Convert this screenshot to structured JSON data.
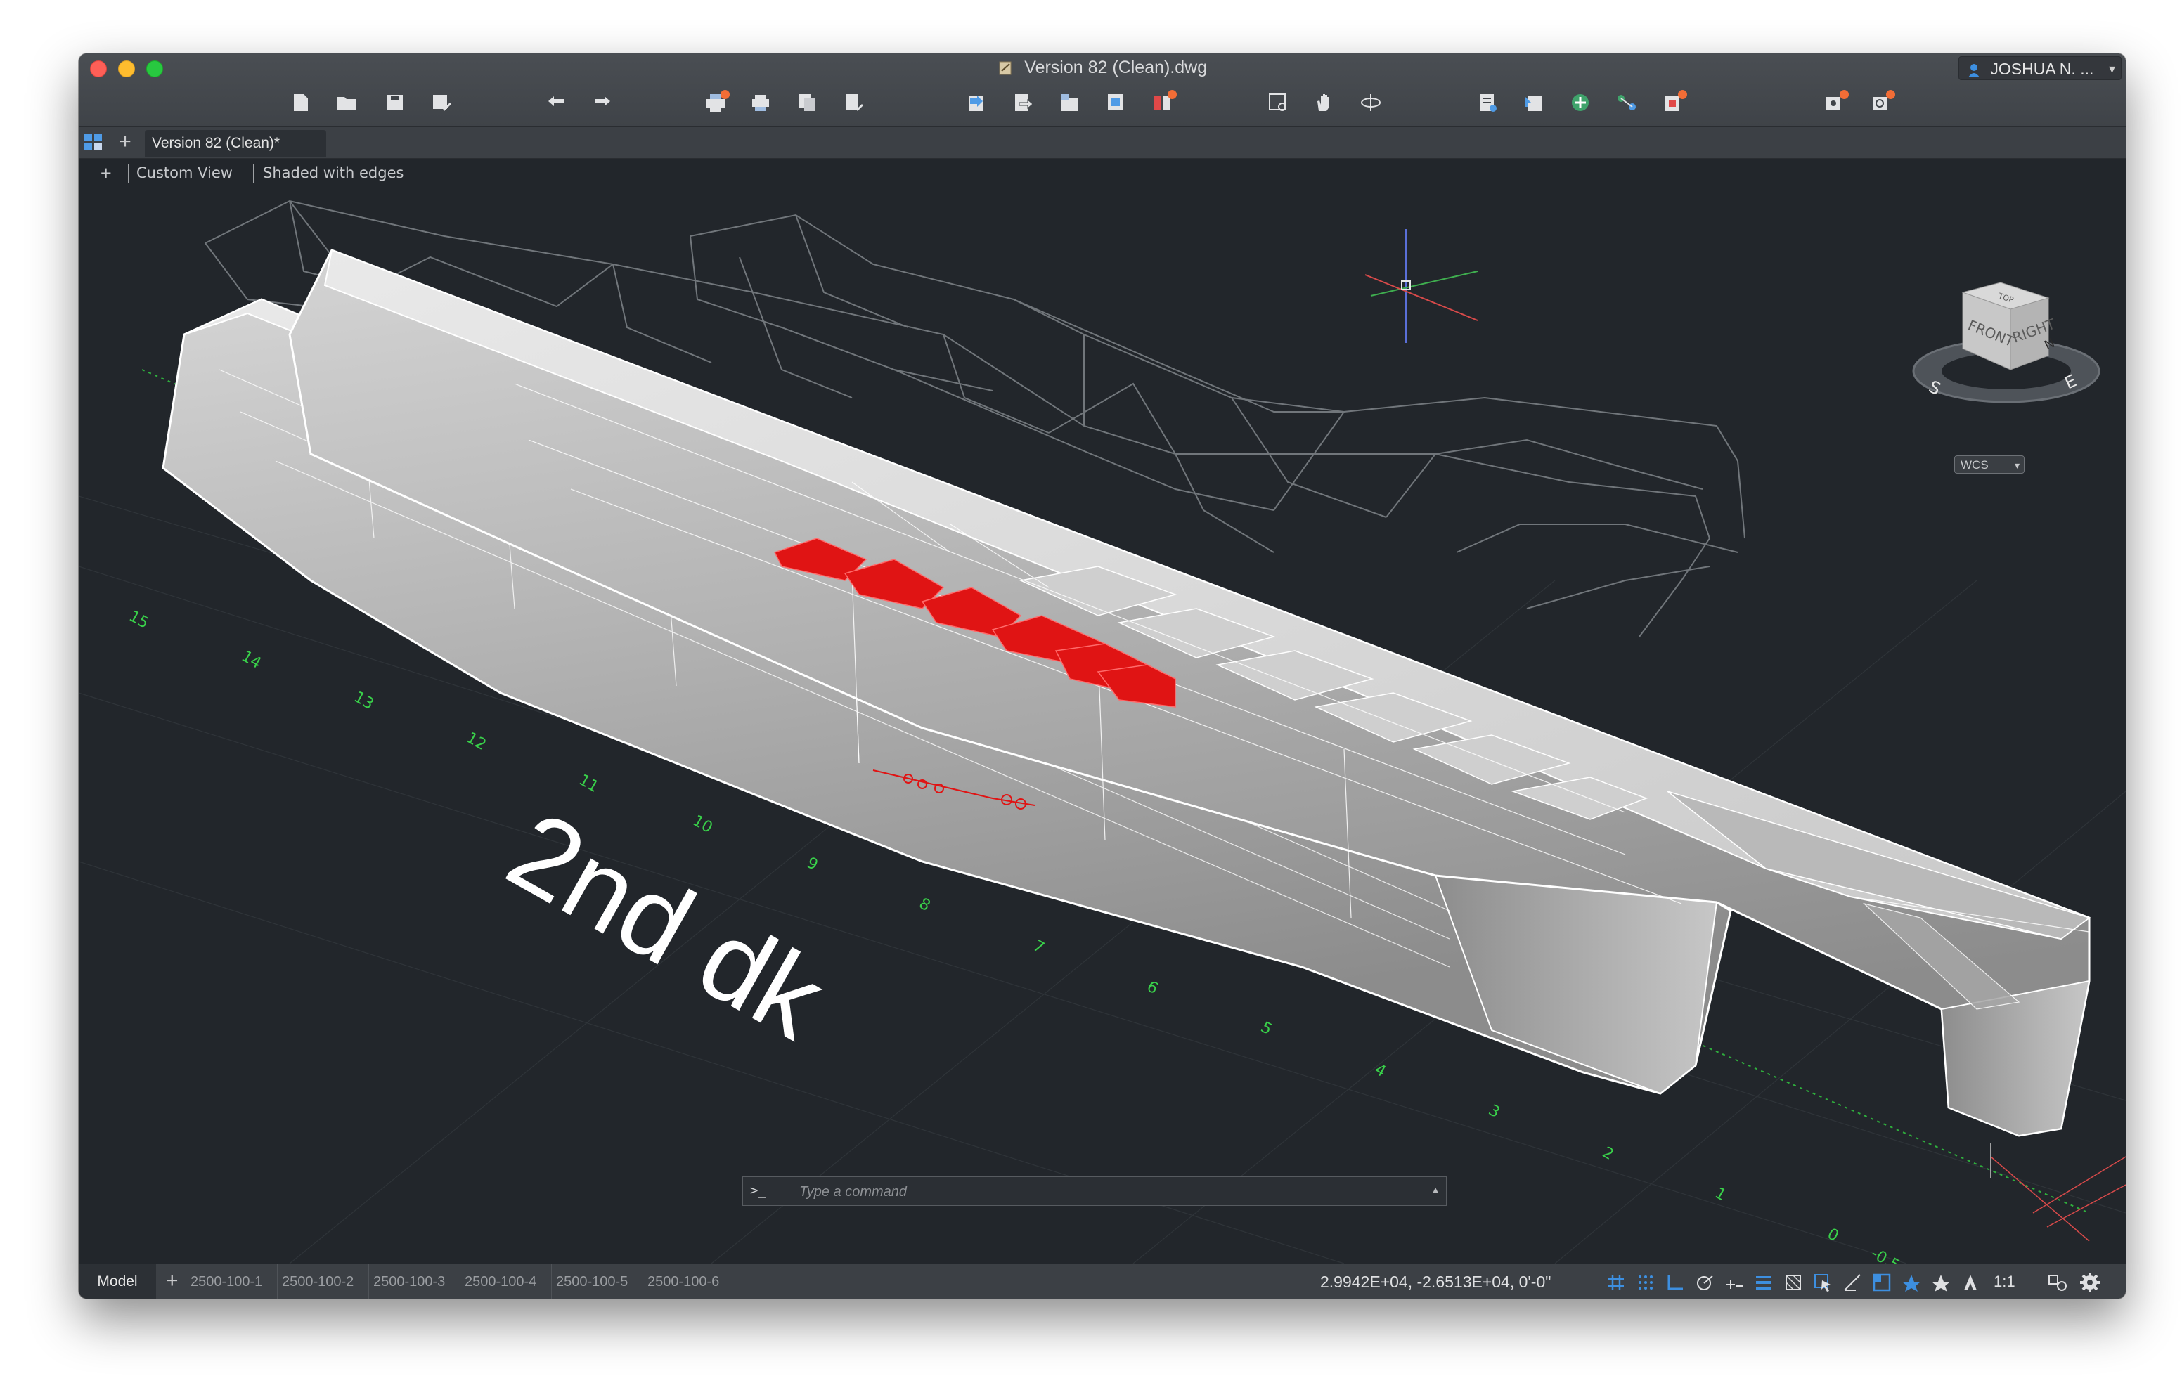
{
  "window": {
    "title": "Version 82 (Clean).dwg",
    "user": "JOSHUA N. ..."
  },
  "toolbar": {
    "buttons": [
      "new-file",
      "open-file",
      "save",
      "save-as",
      "undo",
      "redo",
      "plot",
      "print",
      "page-setup",
      "publish",
      "import",
      "export",
      "attach",
      "xref",
      "manage-xrefs",
      "zoom-window",
      "pan",
      "orbit",
      "properties",
      "match-properties",
      "insert-block",
      "layers",
      "layer-state",
      "extensions",
      "settings"
    ]
  },
  "tabs": {
    "document_tab": "Version 82 (Clean)*"
  },
  "viewport": {
    "view_name": "Custom View",
    "visual_style": "Shaded with edges",
    "annotation": "2nd dk",
    "viewcube": {
      "top": "TOP",
      "front": "FRONT",
      "right": "RIGHT",
      "compass": [
        "S",
        "E",
        "N"
      ]
    },
    "ucs": "WCS",
    "frame_numbers": [
      "15",
      "14",
      "13",
      "12",
      "11",
      "10",
      "9",
      "8",
      "7",
      "6",
      "5",
      "4",
      "3",
      "2",
      "1",
      "0",
      "-0.5"
    ]
  },
  "command": {
    "prompt": ">_",
    "placeholder": "Type a command"
  },
  "status": {
    "model_tab": "Model",
    "layouts": [
      "2500-100-1",
      "2500-100-2",
      "2500-100-3",
      "2500-100-4",
      "2500-100-5",
      "2500-100-6"
    ],
    "coordinates": "2.9942E+04,   -2.6513E+04, 0'-0\"",
    "scale": "1:1",
    "accent_color": "#3d8fe0"
  }
}
